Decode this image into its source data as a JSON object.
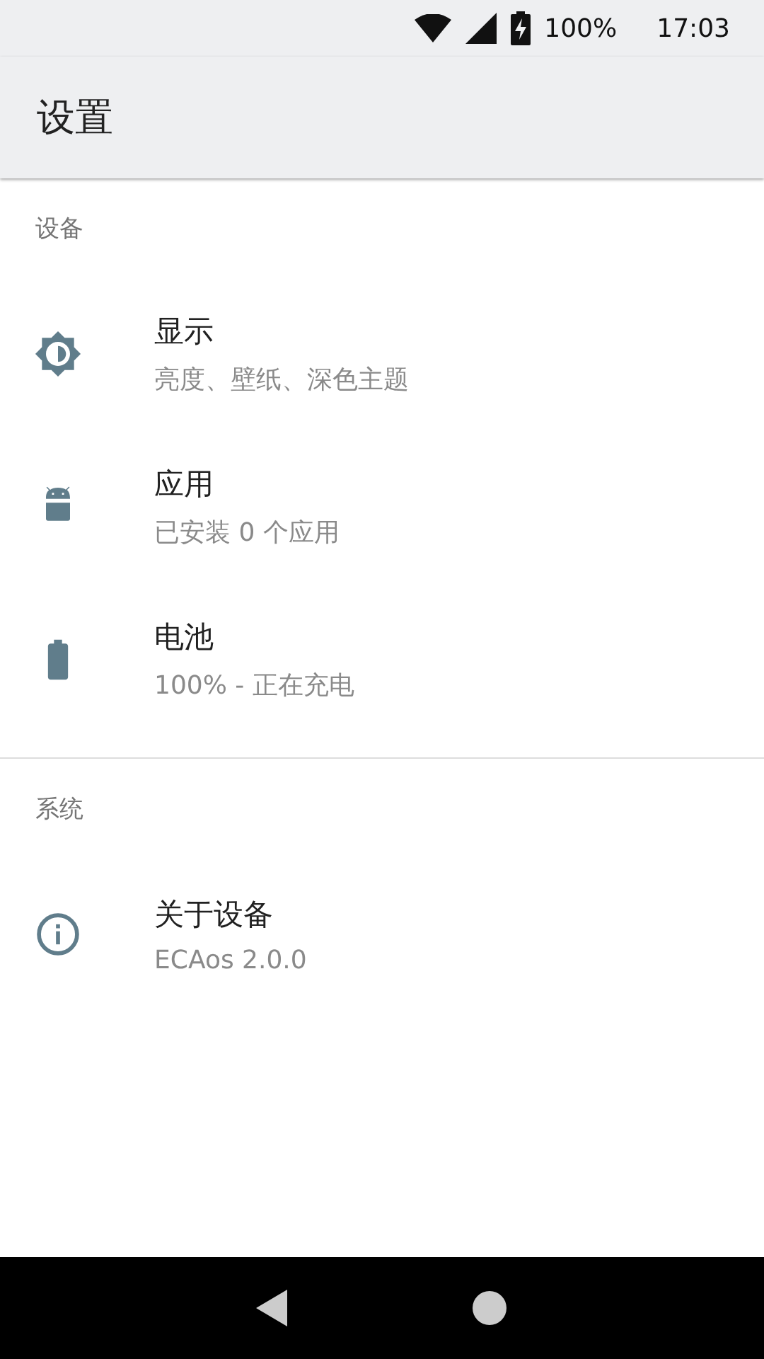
{
  "status_bar": {
    "battery_text": "100%",
    "time": "17:03"
  },
  "app_bar": {
    "title": "设置"
  },
  "sections": [
    {
      "header": "设备",
      "items": [
        {
          "kind": "display",
          "title": "显示",
          "subtitle": "亮度、壁纸、深色主题"
        },
        {
          "kind": "apps",
          "title": "应用",
          "subtitle": "已安装 0 个应用"
        },
        {
          "kind": "battery",
          "title": "电池",
          "subtitle": "100% - 正在充电"
        }
      ]
    },
    {
      "header": "系统",
      "items": [
        {
          "kind": "about",
          "title": "关于设备",
          "subtitle": "ECAos 2.0.0"
        }
      ]
    }
  ]
}
